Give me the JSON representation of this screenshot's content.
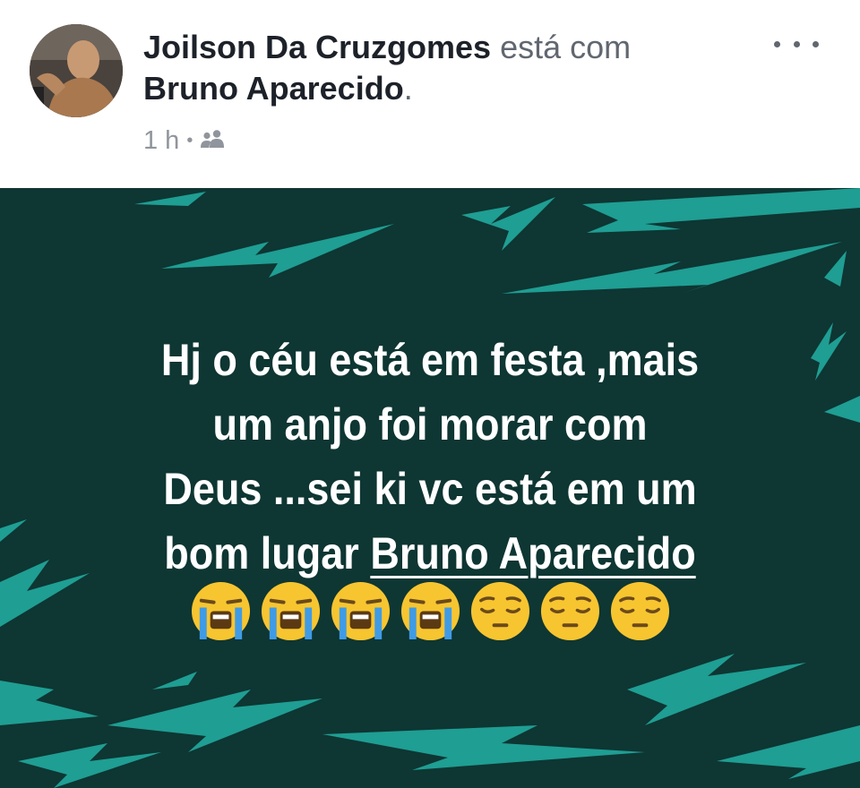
{
  "post": {
    "author": "Joilson Da Cruzgomes",
    "connector": "está com",
    "tagged": "Bruno Aparecido",
    "tagged_suffix": ".",
    "time": "1 h",
    "separator": "•",
    "privacy_icon": "friends-icon",
    "more_icon": "more-options-icon"
  },
  "message": {
    "line1": "Hj o céu está em festa ,mais",
    "line2": "um anjo foi morar com",
    "line3": "Deus ...sei ki vc está em um",
    "line4_prefix": "bom lugar ",
    "line4_mention": "Bruno Aparecido",
    "emojis": [
      "loudly-crying-face",
      "loudly-crying-face",
      "loudly-crying-face",
      "loudly-crying-face",
      "pensive-face",
      "pensive-face",
      "pensive-face"
    ]
  },
  "colors": {
    "background": "#0e3633",
    "bolts": "#1f9e93",
    "text": "#ffffff",
    "author": "#1d2129",
    "meta": "#90949c"
  }
}
